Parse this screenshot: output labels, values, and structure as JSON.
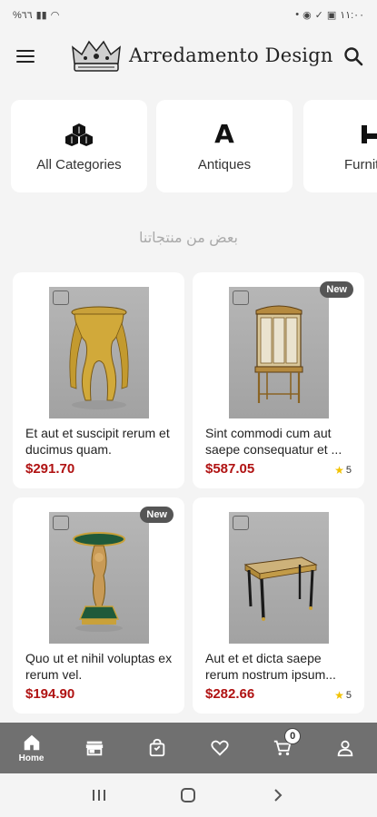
{
  "status": {
    "left_text": "%٦٦",
    "time": "١١:٠٠"
  },
  "header": {
    "brand": "Arredamento Design"
  },
  "categories": [
    {
      "label": "All Categories",
      "icon": "cubes-icon"
    },
    {
      "label": "Antiques",
      "icon": "letter-a-icon",
      "glyph": "A"
    },
    {
      "label": "Furniture",
      "icon": "furniture-icon"
    }
  ],
  "section": {
    "title": "بعض من منتجاتنا"
  },
  "products": [
    {
      "title": "Et aut et suscipit rerum et ducimus quam.",
      "price": "$291.70",
      "new": false,
      "rating": null
    },
    {
      "title": "Sint commodi cum aut saepe consequatur et ...",
      "price": "$587.05",
      "new": true,
      "rating": "5"
    },
    {
      "title": "Quo ut et nihil voluptas ex rerum vel.",
      "price": "$194.90",
      "new": true,
      "rating": null
    },
    {
      "title": "Aut et et dicta saepe rerum nostrum ipsum...",
      "price": "$282.66",
      "new": false,
      "rating": "5"
    }
  ],
  "badges": {
    "new_label": "New"
  },
  "bottom_nav": {
    "home_label": "Home",
    "cart_count": "0"
  },
  "colors": {
    "price": "#b01212",
    "nav_bg": "#707070",
    "star": "#f2c200"
  }
}
